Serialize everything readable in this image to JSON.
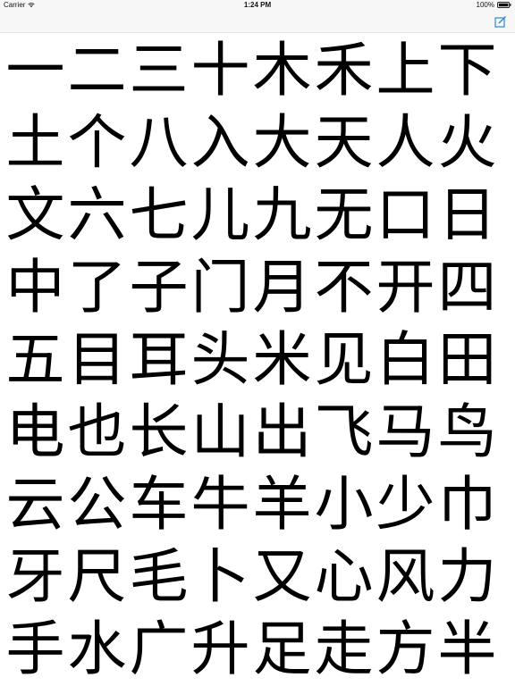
{
  "status_bar": {
    "carrier": "Carrier",
    "time": "1:24 PM",
    "battery": "100%"
  },
  "nav_bar": {
    "compose_icon": "compose-icon"
  },
  "characters": [
    [
      "一",
      "二",
      "三",
      "十",
      "木",
      "禾",
      "上",
      "下"
    ],
    [
      "土",
      "个",
      "八",
      "入",
      "大",
      "天",
      "人",
      "火"
    ],
    [
      "文",
      "六",
      "七",
      "儿",
      "九",
      "无",
      "口",
      "日"
    ],
    [
      "中",
      "了",
      "子",
      "门",
      "月",
      "不",
      "开",
      "四"
    ],
    [
      "五",
      "目",
      "耳",
      "头",
      "米",
      "见",
      "白",
      "田"
    ],
    [
      "电",
      "也",
      "长",
      "山",
      "出",
      "飞",
      "马",
      "鸟"
    ],
    [
      "云",
      "公",
      "车",
      "牛",
      "羊",
      "小",
      "少",
      "巾"
    ],
    [
      "牙",
      "尺",
      "毛",
      "卜",
      "又",
      "心",
      "风",
      "力"
    ],
    [
      "手",
      "水",
      "广",
      "升",
      "足",
      "走",
      "方",
      "半"
    ]
  ],
  "colors": {
    "accent": "#2f86e0"
  }
}
